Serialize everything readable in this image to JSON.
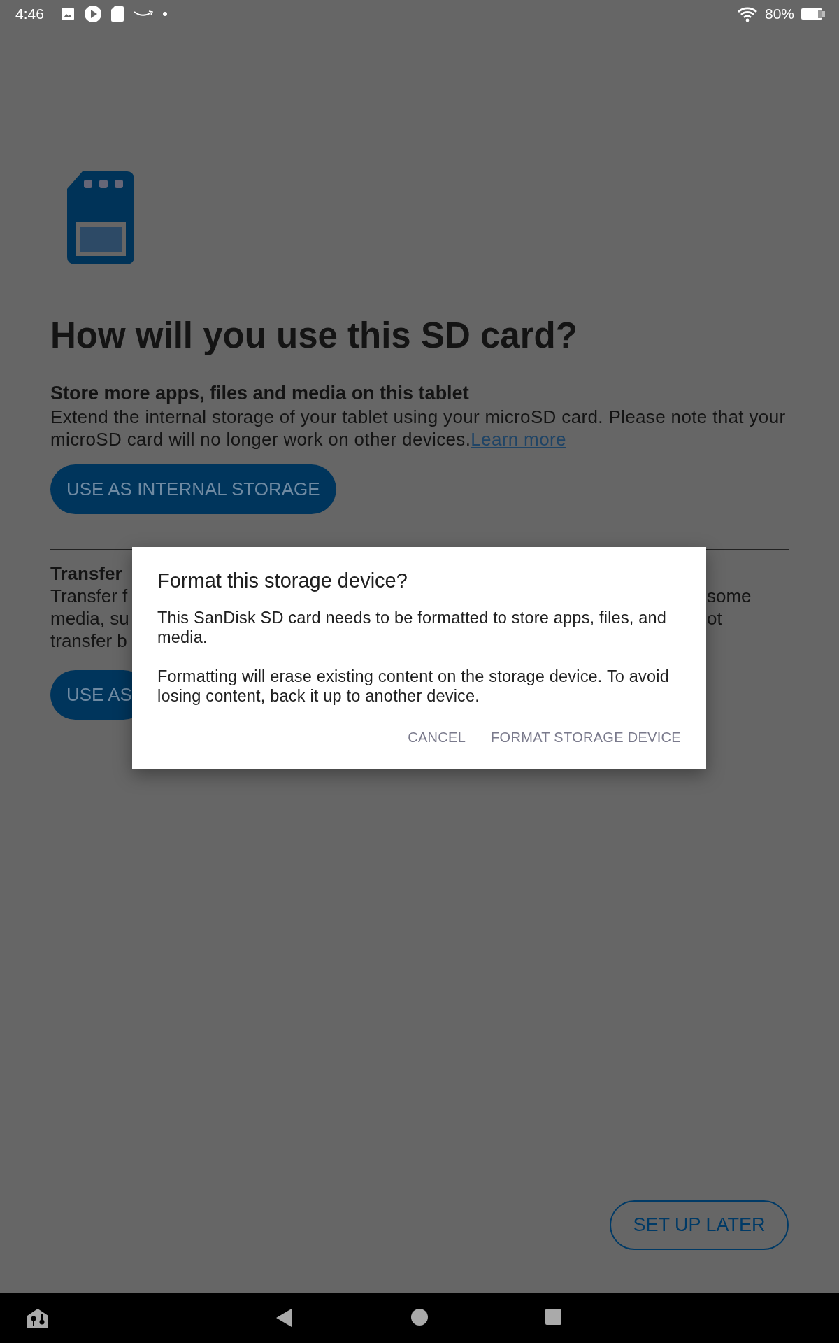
{
  "status_bar": {
    "time": "4:46",
    "battery": "80%"
  },
  "screen": {
    "heading": "How will you use this SD card?",
    "internal": {
      "title": "Store more apps, files and media on this tablet",
      "description": "Extend the internal storage of your tablet using your microSD card. Please note that your microSD card will no longer work on other devices.",
      "link": "Learn more",
      "button": "USE AS INTERNAL STORAGE"
    },
    "transfer": {
      "title": "Transfer",
      "lines": [
        {
          "left": "Transfer f",
          "right": "some"
        },
        {
          "left": "media, su",
          "right": "ot"
        },
        {
          "left": "transfer b"
        }
      ],
      "button": "USE AS"
    },
    "setup_later_button": "SET UP LATER"
  },
  "dialog": {
    "title": "Format this storage device?",
    "paragraphs": [
      "This SanDisk SD card needs to be formatted to store apps, files, and media.",
      "Formatting will erase existing content on the storage device. To avoid losing content, back it up to another device."
    ],
    "buttons": [
      "CANCEL",
      "FORMAT STORAGE DEVICE"
    ]
  }
}
